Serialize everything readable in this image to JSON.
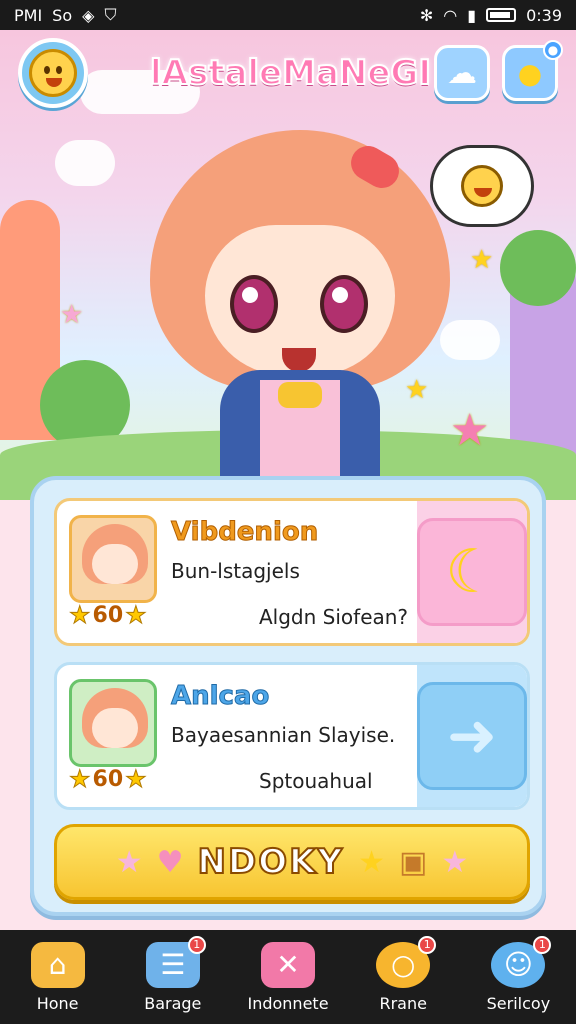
{
  "status_bar": {
    "carrier": "PMI",
    "extra": "So",
    "time": "0:39"
  },
  "header": {
    "title": "lAstaleMaNeGI"
  },
  "cards": [
    {
      "name": "Vibdenion",
      "line1": "Bun-lstagjels",
      "level": "60",
      "line2": "Algdn Siofean?",
      "accent": "#f09a1e"
    },
    {
      "name": "Anlcao",
      "line1": "Bayaesannian Slayise.",
      "level": "60",
      "line2": "Sptouahual",
      "accent": "#4da6e8"
    }
  ],
  "big_button": {
    "label": "NDOKY"
  },
  "bottom_nav": [
    {
      "label": "Hone",
      "icon": "home-icon",
      "badge": ""
    },
    {
      "label": "Barage",
      "icon": "inbox-icon",
      "badge": "1"
    },
    {
      "label": "Indonnete",
      "icon": "close-box-icon",
      "badge": ""
    },
    {
      "label": "Rrane",
      "icon": "search-ring-icon",
      "badge": "1"
    },
    {
      "label": "Serilcoy",
      "icon": "smiley-icon",
      "badge": "1"
    }
  ]
}
